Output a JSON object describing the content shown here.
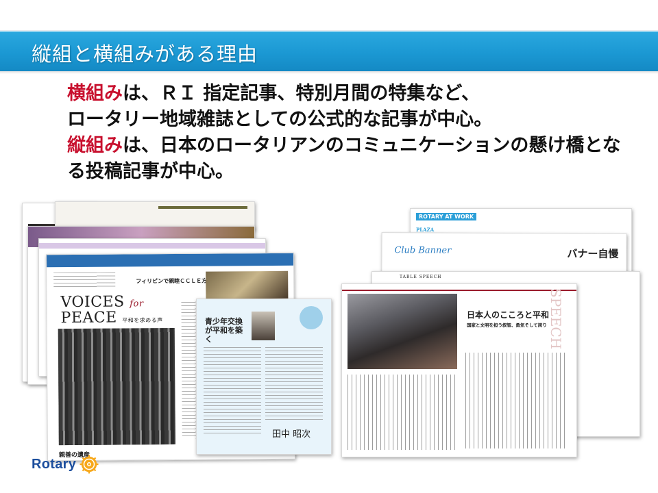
{
  "slide": {
    "title": "縦組と横組みがある理由",
    "body": {
      "line1_highlight": "横組み",
      "line1_rest": "は、ＲＩ 指定記事、特別月間の特集など、",
      "line2": "ロータリー地域雑誌としての公式的な記事が中心。",
      "line3_highlight": "縦組み",
      "line3_rest": "は、日本のロータリアンのコミュニケーションの懸け橋とな",
      "line4": "る投稿記事が中心。"
    }
  },
  "collage": {
    "left_spread": {
      "headline_en_1": "VOICES",
      "headline_en_for": "for",
      "headline_en_2": "PEACE",
      "headline_jp": "平和を求める声",
      "section": "フィリピンで親睦ＣＣＬＥ方式授業",
      "interview_title": "青少年交換が平和を築く",
      "bottom_caption": "親善の遺産"
    },
    "right_spread": {
      "header_at_work": "ROTARY AT WORK",
      "header_plaza": "PLAZA",
      "club_banner": "Club Banner",
      "banner_jp": "バナー自慢",
      "table_speech": "TABLE SPEECH",
      "speech_title": "日本人のこころと平和",
      "speech_subtitle": "国家と文明を担う叙智、勇気そして誇り",
      "speech_vertical": "SPEECH"
    }
  },
  "logo": {
    "text": "Rotary",
    "color": "#1c4e9d",
    "wheel_color": "#f7a81b"
  },
  "colors": {
    "title_bar": "#1b98d3",
    "highlight": "#c8102e"
  }
}
